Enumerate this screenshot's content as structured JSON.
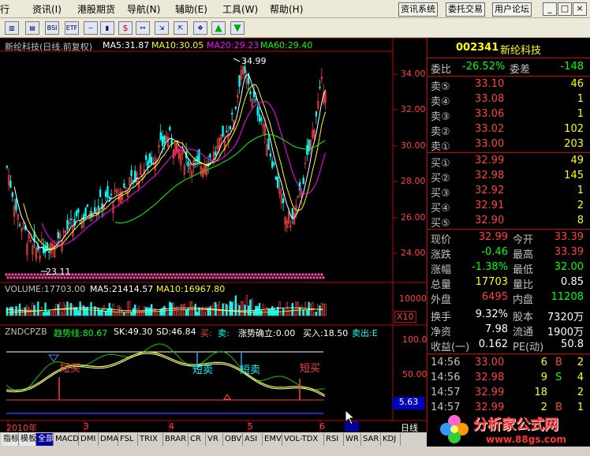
{
  "menu": {
    "items": [
      "行",
      "资讯(I)",
      "港股期货",
      "导航(N)",
      "辅助(E)",
      "工具(W)",
      "帮助(H)"
    ],
    "right_buttons": [
      "资讯系统",
      "委托交易",
      "用户论坛"
    ],
    "window_buttons": [
      "_",
      "□",
      "×"
    ]
  },
  "toolbar": {
    "icons": [
      "bars-icon",
      "chart-icon",
      "bsi-icon",
      "etf-icon",
      "line-icon",
      "bar-icon",
      "dollar-icon",
      "link-icon",
      "import-icon",
      "export-icon",
      "move-icon",
      "up-arrow-icon",
      "down-arrow-icon"
    ],
    "labels": [
      "",
      "",
      "BSI",
      "ETF",
      "",
      "",
      "$",
      "",
      "",
      "",
      "",
      "",
      ""
    ]
  },
  "chart": {
    "title": "新纶科技(日线.前复权)",
    "ma": [
      {
        "label": "MA5:31.87",
        "color": "#ffffff"
      },
      {
        "label": "MA10:30.05",
        "color": "#ffff00"
      },
      {
        "label": "MA20:29.23",
        "color": "#ff00ff"
      },
      {
        "label": "MA60:29.40",
        "color": "#00ff00"
      }
    ],
    "y_ticks": [
      "34.00",
      "32.00",
      "30.00",
      "28.00",
      "26.00",
      "24.00"
    ],
    "high_label": "34.99",
    "low_label": "23.11",
    "volume": {
      "label": "VOLUME:17703.00",
      "ma5": "MA5:21414.57",
      "ma10": "MA10:16967.80",
      "y_tick": "10000",
      "unit": "X10"
    },
    "indicator": {
      "name": "ZNDCPZB",
      "trend": "趋势线:80.67",
      "sk": "SK:49.30",
      "sd": "SD:46.84",
      "buy": "买:",
      "sell_dash": "卖:",
      "confirm": "涨势确立:0.00",
      "buy_in": "买入:18.50",
      "sell_out": "卖出:E",
      "y_ticks": [
        "100.00",
        "50.00"
      ],
      "value_box": "5.63",
      "annotations": [
        "短买",
        "短卖",
        "短卖",
        "短买"
      ]
    },
    "x_labels": [
      "2010年",
      "3",
      "4",
      "5",
      "6"
    ],
    "period": "日线"
  },
  "bottom_tabs": [
    "指标",
    "模板",
    "全部",
    "MACD",
    "DMI",
    "DMA",
    "FSL",
    "TRIX",
    "BRAR",
    "CR",
    "VR",
    "OBV",
    "ASI",
    "EMV",
    "VOL-TDX",
    "RSI",
    "WR",
    "SAR",
    "KDJ"
  ],
  "quote": {
    "code": "002341",
    "name": "新纶科技",
    "weibi_label": "委比",
    "weibi": "-26.52%",
    "weicha_label": "委差",
    "weicha": "-148",
    "sell": [
      {
        "label": "卖⑤",
        "price": "33.10",
        "vol": "46"
      },
      {
        "label": "卖④",
        "price": "33.08",
        "vol": "1"
      },
      {
        "label": "卖③",
        "price": "33.06",
        "vol": "1"
      },
      {
        "label": "卖②",
        "price": "33.02",
        "vol": "102"
      },
      {
        "label": "卖①",
        "price": "33.00",
        "vol": "203"
      }
    ],
    "buy": [
      {
        "label": "买①",
        "price": "32.99",
        "vol": "49"
      },
      {
        "label": "买②",
        "price": "32.98",
        "vol": "145"
      },
      {
        "label": "买③",
        "price": "32.92",
        "vol": "1"
      },
      {
        "label": "买④",
        "price": "32.91",
        "vol": "2"
      },
      {
        "label": "买⑤",
        "price": "32.90",
        "vol": "8"
      }
    ],
    "stats": [
      {
        "l1": "现价",
        "v1": "32.99",
        "c1": "#ff4040",
        "l2": "今开",
        "v2": "33.39",
        "c2": "#ff4040"
      },
      {
        "l1": "涨跌",
        "v1": "-0.46",
        "c1": "#00ff00",
        "l2": "最高",
        "v2": "33.39",
        "c2": "#ff4040"
      },
      {
        "l1": "涨幅",
        "v1": "-1.38%",
        "c1": "#00ff00",
        "l2": "最低",
        "v2": "32.00",
        "c2": "#00ff00"
      },
      {
        "l1": "总量",
        "v1": "17703",
        "c1": "#ffff00",
        "l2": "量比",
        "v2": "0.85",
        "c2": "#ffffff"
      },
      {
        "l1": "外盘",
        "v1": "6495",
        "c1": "#ff4040",
        "l2": "内盘",
        "v2": "11208",
        "c2": "#00ff00"
      },
      {
        "l1": "换手",
        "v1": "9.32%",
        "c1": "#ffffff",
        "l2": "股本",
        "v2": "7320万",
        "c2": "#ffffff"
      },
      {
        "l1": "净资",
        "v1": "7.98",
        "c1": "#ffffff",
        "l2": "流通",
        "v2": "1900万",
        "c2": "#ffffff"
      },
      {
        "l1": "收益(一)",
        "v1": "0.162",
        "c1": "#ffffff",
        "l2": "PE(动)",
        "v2": "50.8",
        "c2": "#ffffff"
      }
    ],
    "ticks": [
      {
        "time": "14:56",
        "price": "33.00",
        "vol": "6",
        "side": "B",
        "num": "2",
        "sidecolor": "#ff4040"
      },
      {
        "time": "14:56",
        "price": "32.98",
        "vol": "9",
        "side": "S",
        "num": "4",
        "sidecolor": "#00ff00"
      },
      {
        "time": "14:57",
        "price": "32.99",
        "vol": "18",
        "side": "",
        "num": "2",
        "sidecolor": "#ffffff"
      },
      {
        "time": "14:57",
        "price": "32.99",
        "vol": "2",
        "side": "B",
        "num": "1",
        "sidecolor": "#ff4040"
      }
    ]
  },
  "watermark": {
    "title": "分析家公式网",
    "url": "www.88gs.com"
  },
  "colors": {
    "up": "#ff4040",
    "down": "#00ffff",
    "axis_red": "#c00000",
    "ma5": "#ffffff",
    "ma10": "#ffff00",
    "ma20": "#ff00ff",
    "ma60": "#00ff00"
  }
}
